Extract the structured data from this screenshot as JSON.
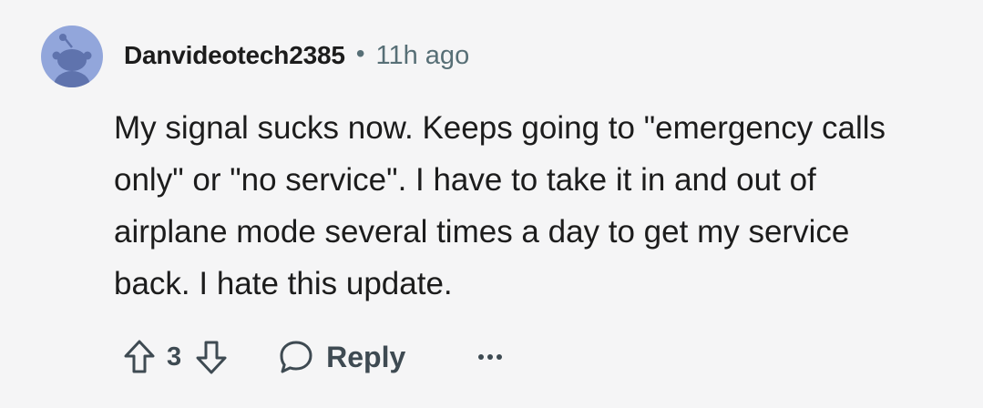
{
  "comment": {
    "author": "Danvideotech2385",
    "separator": "•",
    "timestamp": "11h ago",
    "body": "My signal sucks now. Keeps going to \"emergency calls only\" or \"no service\". I have to take it in and out of airplane mode several times a day to get my service back. I hate this update.",
    "score": "3",
    "reply_label": "Reply"
  },
  "icons": {
    "avatar": "snoo-avatar-icon",
    "upvote": "upvote-arrow-icon",
    "downvote": "downvote-arrow-icon",
    "reply": "speech-bubble-icon",
    "more": "more-dots-icon"
  },
  "colors": {
    "background": "#f5f5f6",
    "avatar_bg": "#92a6db",
    "avatar_figure": "#5f73ad",
    "text": "#1c1c1c",
    "meta_text": "#576f76",
    "action_text": "#3e4a52"
  }
}
